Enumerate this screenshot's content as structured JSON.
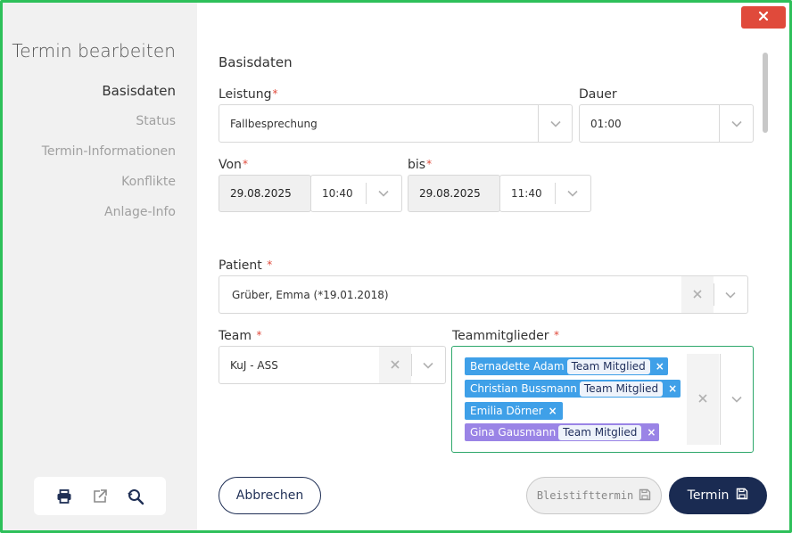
{
  "dialog": {
    "title": "Termin bearbeiten",
    "close_icon": "close-icon"
  },
  "sidebar": {
    "items": [
      {
        "label": "Basisdaten",
        "active": true
      },
      {
        "label": "Status",
        "active": false
      },
      {
        "label": "Termin-Informationen",
        "active": false
      },
      {
        "label": "Konflikte",
        "active": false
      },
      {
        "label": "Anlage-Info",
        "active": false
      }
    ],
    "tools": [
      "print-icon",
      "external-link-icon",
      "search-refresh-icon"
    ]
  },
  "form": {
    "section_title": "Basisdaten",
    "leistung": {
      "label": "Leistung",
      "required": "*",
      "value": "Fallbesprechung"
    },
    "dauer": {
      "label": "Dauer",
      "value": "01:00"
    },
    "von": {
      "label": "Von",
      "required": "*",
      "date": "29.08.2025",
      "time": "10:40"
    },
    "bis": {
      "label": "bis",
      "required": "*",
      "date": "29.08.2025",
      "time": "11:40"
    },
    "patient": {
      "label": "Patient",
      "required": "*",
      "value": "Grüber, Emma (*19.01.2018)"
    },
    "team": {
      "label": "Team",
      "required": "*",
      "value": "KuJ - ASS"
    },
    "teammitglieder": {
      "label": "Teammitglieder",
      "required": "*",
      "tags": [
        {
          "name": "Bernadette Adam",
          "badge": "Team Mitglied",
          "color": "blue"
        },
        {
          "name": "Christian Bussmann",
          "badge": "Team Mitglied",
          "color": "blue"
        },
        {
          "name": "Emilia Dörner",
          "badge": "",
          "color": "blue"
        },
        {
          "name": "Gina Gausmann",
          "badge": "Team Mitglied",
          "color": "purple"
        }
      ],
      "remove_glyph": "×"
    }
  },
  "buttons": {
    "cancel": "Abbrechen",
    "draft": "Bleistifttermin",
    "save": "Termin"
  },
  "colors": {
    "accent_green": "#2ec05a",
    "close_red": "#e04a3b",
    "navy": "#1a2b52",
    "tag_blue": "#3fa0e8",
    "tag_purple": "#9a84e6"
  }
}
